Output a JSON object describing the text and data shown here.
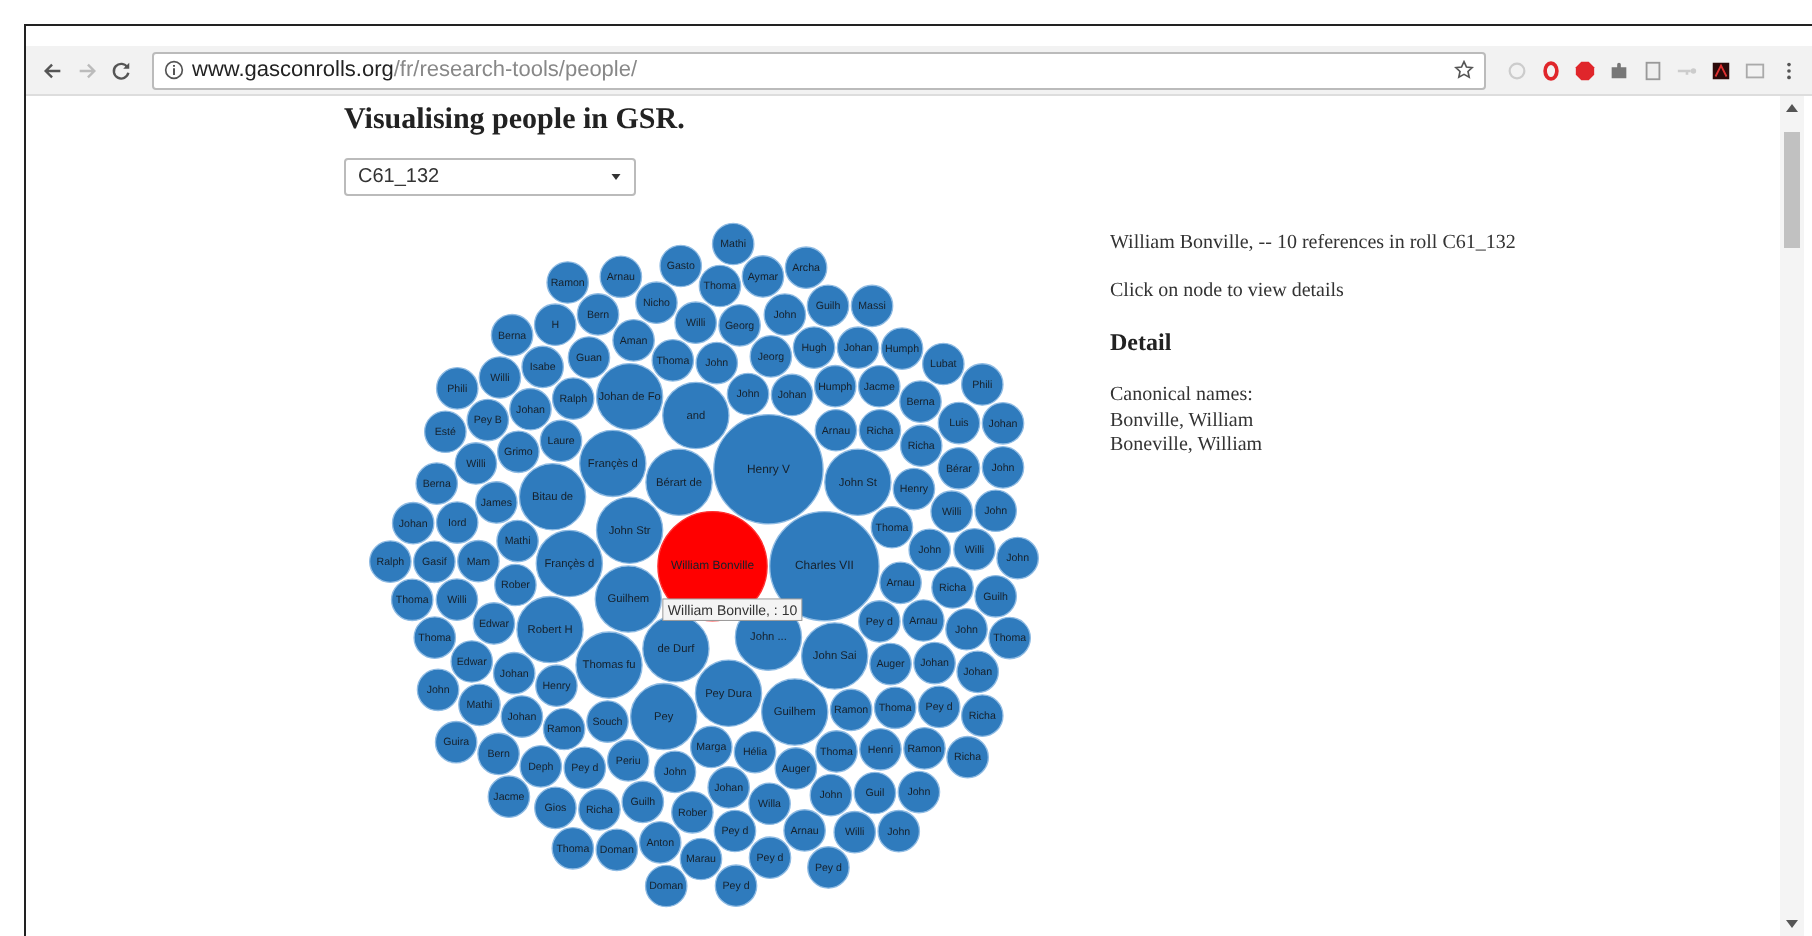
{
  "browser": {
    "url_host": "www.gasconrolls.org",
    "url_path": "/fr/research-tools/people/"
  },
  "page": {
    "title": "Visualising people in GSR.",
    "roll_select": "C61_132"
  },
  "chart": {
    "tooltip": "William Bonville, : 10",
    "nodes": [
      {
        "label": "William Bonville",
        "kind": "big",
        "selected": true
      },
      {
        "label": "Charles VII",
        "kind": "big",
        "selected": false
      },
      {
        "label": "Henry V",
        "kind": "big",
        "selected": false
      },
      {
        "label": "Johan de Fo",
        "kind": "mid",
        "selected": false
      },
      {
        "label": "and",
        "kind": "mid",
        "selected": false
      },
      {
        "label": "Françès d",
        "kind": "mid",
        "selected": false
      },
      {
        "label": "Bérart de",
        "kind": "mid",
        "selected": false
      },
      {
        "label": "John St",
        "kind": "mid",
        "selected": false
      },
      {
        "label": "Bitau de",
        "kind": "mid",
        "selected": false
      },
      {
        "label": "John Str",
        "kind": "mid",
        "selected": false
      },
      {
        "label": "Françès d",
        "kind": "mid",
        "selected": false
      },
      {
        "label": "Guilhem",
        "kind": "mid",
        "selected": false
      },
      {
        "label": "Robert H",
        "kind": "mid",
        "selected": false
      },
      {
        "label": "de Durf",
        "kind": "mid",
        "selected": false
      },
      {
        "label": "John ...",
        "kind": "mid",
        "selected": false
      },
      {
        "label": "Thomas fu",
        "kind": "mid",
        "selected": false
      },
      {
        "label": "John Sai",
        "kind": "mid",
        "selected": false
      },
      {
        "label": "Pey Dura",
        "kind": "mid",
        "selected": false
      },
      {
        "label": "Pey",
        "kind": "mid",
        "selected": false
      },
      {
        "label": "Guilhem",
        "kind": "mid",
        "selected": false
      },
      {
        "label": "Mathi",
        "kind": "small",
        "selected": false
      },
      {
        "label": "Arnau",
        "kind": "small",
        "selected": false
      },
      {
        "label": "Gasto",
        "kind": "small",
        "selected": false
      },
      {
        "label": "Aymar",
        "kind": "small",
        "selected": false
      },
      {
        "label": "Archa",
        "kind": "small",
        "selected": false
      },
      {
        "label": "Ramon",
        "kind": "small",
        "selected": false
      },
      {
        "label": "Thoma",
        "kind": "small",
        "selected": false
      },
      {
        "label": "Bern",
        "kind": "small",
        "selected": false
      },
      {
        "label": "Nicho",
        "kind": "small",
        "selected": false
      },
      {
        "label": "John",
        "kind": "small",
        "selected": false
      },
      {
        "label": "Guilh",
        "kind": "small",
        "selected": false
      },
      {
        "label": "Massi",
        "kind": "small",
        "selected": false
      },
      {
        "label": "Berna",
        "kind": "small",
        "selected": false
      },
      {
        "label": "H",
        "kind": "small",
        "selected": false
      },
      {
        "label": "Willi",
        "kind": "small",
        "selected": false
      },
      {
        "label": "Georg",
        "kind": "small",
        "selected": false
      },
      {
        "label": "Aman",
        "kind": "small",
        "selected": false
      },
      {
        "label": "Guan",
        "kind": "small",
        "selected": false
      },
      {
        "label": "Thoma",
        "kind": "small",
        "selected": false
      },
      {
        "label": "Jeorg",
        "kind": "small",
        "selected": false
      },
      {
        "label": "Hugh",
        "kind": "small",
        "selected": false
      },
      {
        "label": "Johan",
        "kind": "small",
        "selected": false
      },
      {
        "label": "Humph",
        "kind": "small",
        "selected": false
      },
      {
        "label": "Isabe",
        "kind": "small",
        "selected": false
      },
      {
        "label": "John",
        "kind": "small",
        "selected": false
      },
      {
        "label": "Lubat",
        "kind": "small",
        "selected": false
      },
      {
        "label": "Phili",
        "kind": "small",
        "selected": false
      },
      {
        "label": "Willi",
        "kind": "small",
        "selected": false
      },
      {
        "label": "John",
        "kind": "small",
        "selected": false
      },
      {
        "label": "Johan",
        "kind": "small",
        "selected": false
      },
      {
        "label": "Humph",
        "kind": "small",
        "selected": false
      },
      {
        "label": "Jacme",
        "kind": "small",
        "selected": false
      },
      {
        "label": "Phili",
        "kind": "small",
        "selected": false
      },
      {
        "label": "Johan",
        "kind": "small",
        "selected": false
      },
      {
        "label": "Ralph",
        "kind": "small",
        "selected": false
      },
      {
        "label": "Berna",
        "kind": "small",
        "selected": false
      },
      {
        "label": "Esté",
        "kind": "small",
        "selected": false
      },
      {
        "label": "Pey B",
        "kind": "small",
        "selected": false
      },
      {
        "label": "Arnau",
        "kind": "small",
        "selected": false
      },
      {
        "label": "Richa",
        "kind": "small",
        "selected": false
      },
      {
        "label": "Luis",
        "kind": "small",
        "selected": false
      },
      {
        "label": "Johan",
        "kind": "small",
        "selected": false
      },
      {
        "label": "Grimo",
        "kind": "small",
        "selected": false
      },
      {
        "label": "Laure",
        "kind": "small",
        "selected": false
      },
      {
        "label": "Richa",
        "kind": "small",
        "selected": false
      },
      {
        "label": "Willi",
        "kind": "small",
        "selected": false
      },
      {
        "label": "Bérar",
        "kind": "small",
        "selected": false
      },
      {
        "label": "John",
        "kind": "small",
        "selected": false
      },
      {
        "label": "Berna",
        "kind": "small",
        "selected": false
      },
      {
        "label": "Henry",
        "kind": "small",
        "selected": false
      },
      {
        "label": "James",
        "kind": "small",
        "selected": false
      },
      {
        "label": "Johan",
        "kind": "small",
        "selected": false
      },
      {
        "label": "Iord",
        "kind": "small",
        "selected": false
      },
      {
        "label": "Willi",
        "kind": "small",
        "selected": false
      },
      {
        "label": "John",
        "kind": "small",
        "selected": false
      },
      {
        "label": "Thoma",
        "kind": "small",
        "selected": false
      },
      {
        "label": "Mathi",
        "kind": "small",
        "selected": false
      },
      {
        "label": "Ralph",
        "kind": "small",
        "selected": false
      },
      {
        "label": "Gasif",
        "kind": "small",
        "selected": false
      },
      {
        "label": "Mam",
        "kind": "small",
        "selected": false
      },
      {
        "label": "John",
        "kind": "small",
        "selected": false
      },
      {
        "label": "Willi",
        "kind": "small",
        "selected": false
      },
      {
        "label": "John",
        "kind": "small",
        "selected": false
      },
      {
        "label": "Rober",
        "kind": "small",
        "selected": false
      },
      {
        "label": "Arnau",
        "kind": "small",
        "selected": false
      },
      {
        "label": "Thoma",
        "kind": "small",
        "selected": false
      },
      {
        "label": "Willi",
        "kind": "small",
        "selected": false
      },
      {
        "label": "Richa",
        "kind": "small",
        "selected": false
      },
      {
        "label": "Guilh",
        "kind": "small",
        "selected": false
      },
      {
        "label": "Edwar",
        "kind": "small",
        "selected": false
      },
      {
        "label": "Pey d",
        "kind": "small",
        "selected": false
      },
      {
        "label": "Arnau",
        "kind": "small",
        "selected": false
      },
      {
        "label": "Thoma",
        "kind": "small",
        "selected": false
      },
      {
        "label": "John",
        "kind": "small",
        "selected": false
      },
      {
        "label": "Thoma",
        "kind": "small",
        "selected": false
      },
      {
        "label": "Edwar",
        "kind": "small",
        "selected": false
      },
      {
        "label": "Johan",
        "kind": "small",
        "selected": false
      },
      {
        "label": "Auger",
        "kind": "small",
        "selected": false
      },
      {
        "label": "Johan",
        "kind": "small",
        "selected": false
      },
      {
        "label": "Johan",
        "kind": "small",
        "selected": false
      },
      {
        "label": "John",
        "kind": "small",
        "selected": false
      },
      {
        "label": "Henry",
        "kind": "small",
        "selected": false
      },
      {
        "label": "Mathi",
        "kind": "small",
        "selected": false
      },
      {
        "label": "Johan",
        "kind": "small",
        "selected": false
      },
      {
        "label": "Ramon",
        "kind": "small",
        "selected": false
      },
      {
        "label": "Thoma",
        "kind": "small",
        "selected": false
      },
      {
        "label": "Pey d",
        "kind": "small",
        "selected": false
      },
      {
        "label": "Souch",
        "kind": "small",
        "selected": false
      },
      {
        "label": "Richa",
        "kind": "small",
        "selected": false
      },
      {
        "label": "Guira",
        "kind": "small",
        "selected": false
      },
      {
        "label": "Ramon",
        "kind": "small",
        "selected": false
      },
      {
        "label": "Bern",
        "kind": "small",
        "selected": false
      },
      {
        "label": "Marga",
        "kind": "small",
        "selected": false
      },
      {
        "label": "Periu",
        "kind": "small",
        "selected": false
      },
      {
        "label": "Hélia",
        "kind": "small",
        "selected": false
      },
      {
        "label": "Thoma",
        "kind": "small",
        "selected": false
      },
      {
        "label": "Henri",
        "kind": "small",
        "selected": false
      },
      {
        "label": "Ramon",
        "kind": "small",
        "selected": false
      },
      {
        "label": "Deph",
        "kind": "small",
        "selected": false
      },
      {
        "label": "Pey d",
        "kind": "small",
        "selected": false
      },
      {
        "label": "Auger",
        "kind": "small",
        "selected": false
      },
      {
        "label": "Richa",
        "kind": "small",
        "selected": false
      },
      {
        "label": "John",
        "kind": "small",
        "selected": false
      },
      {
        "label": "Jacme",
        "kind": "small",
        "selected": false
      },
      {
        "label": "Johan",
        "kind": "small",
        "selected": false
      },
      {
        "label": "Guilh",
        "kind": "small",
        "selected": false
      },
      {
        "label": "Willa",
        "kind": "small",
        "selected": false
      },
      {
        "label": "John",
        "kind": "small",
        "selected": false
      },
      {
        "label": "Guil",
        "kind": "small",
        "selected": false
      },
      {
        "label": "John",
        "kind": "small",
        "selected": false
      },
      {
        "label": "Gios",
        "kind": "small",
        "selected": false
      },
      {
        "label": "Richa",
        "kind": "small",
        "selected": false
      },
      {
        "label": "Rober",
        "kind": "small",
        "selected": false
      },
      {
        "label": "Anton",
        "kind": "small",
        "selected": false
      },
      {
        "label": "Pey d",
        "kind": "small",
        "selected": false
      },
      {
        "label": "Arnau",
        "kind": "small",
        "selected": false
      },
      {
        "label": "Willi",
        "kind": "small",
        "selected": false
      },
      {
        "label": "John",
        "kind": "small",
        "selected": false
      },
      {
        "label": "Thoma",
        "kind": "small",
        "selected": false
      },
      {
        "label": "Doman",
        "kind": "small",
        "selected": false
      },
      {
        "label": "Marau",
        "kind": "small",
        "selected": false
      },
      {
        "label": "Pey d",
        "kind": "small",
        "selected": false
      },
      {
        "label": "Pey d",
        "kind": "small",
        "selected": false
      },
      {
        "label": "Doman",
        "kind": "small",
        "selected": false
      },
      {
        "label": "Pey d",
        "kind": "small",
        "selected": false
      }
    ]
  },
  "info": {
    "summary": "William Bonville, -- 10 references in roll C61_132",
    "hint": "Click on node to view details",
    "detail_heading": "Detail",
    "canonical_label": "Canonical names:",
    "canonical_names": [
      "Bonville, William",
      "Boneville, William"
    ]
  }
}
